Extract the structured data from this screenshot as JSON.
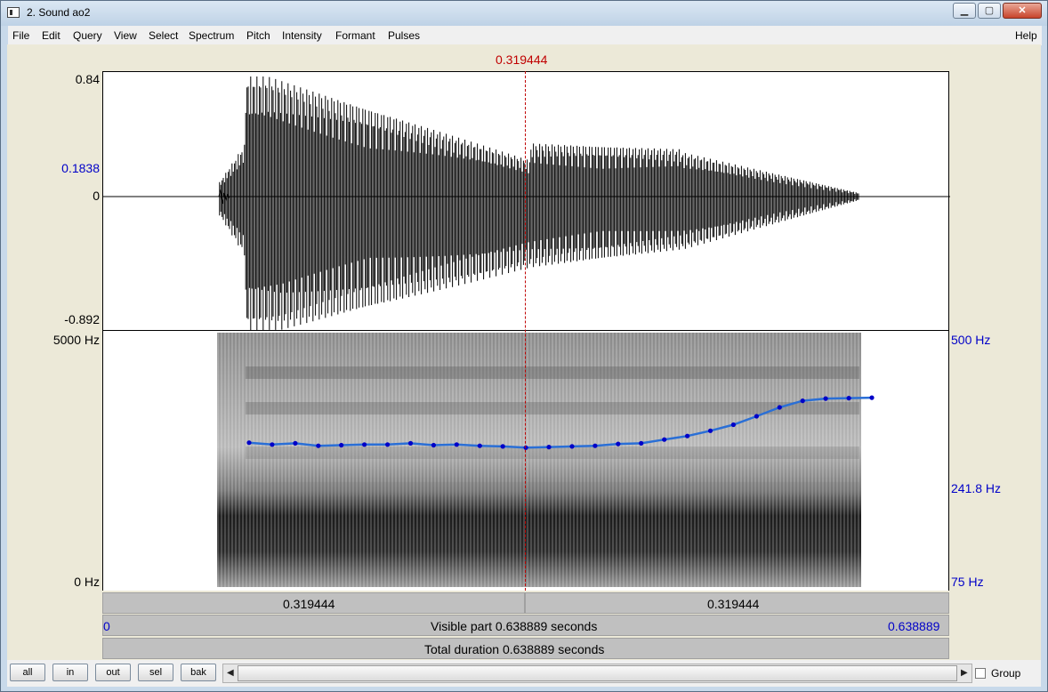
{
  "window": {
    "title": "2. Sound ao2",
    "controls": [
      "minimize",
      "maximize",
      "close"
    ]
  },
  "menu": {
    "items": [
      "File",
      "Edit",
      "Query",
      "View",
      "Select",
      "Spectrum",
      "Pitch",
      "Intensity",
      "Formant",
      "Pulses"
    ],
    "help": "Help"
  },
  "cursor": {
    "time_label": "0.319444",
    "time": 0.319444
  },
  "waveform": {
    "y_max": "0.84",
    "y_mark": "0.1838",
    "y_zero": "0",
    "y_min": "-0.892"
  },
  "spectrogram": {
    "freq_top": "5000 Hz",
    "freq_bottom": "0 Hz"
  },
  "pitch": {
    "top": "500 Hz",
    "mid": "241.8 Hz",
    "bottom": "75 Hz",
    "contour_hz": [
      221,
      218,
      220,
      216,
      217,
      218,
      218,
      220,
      217,
      218,
      216,
      215,
      213,
      214,
      215,
      216,
      219,
      220,
      226,
      232,
      241,
      252,
      268,
      286,
      300,
      305,
      306,
      307
    ]
  },
  "time_bar": {
    "left_label": "0.319444",
    "right_label": "0.319444"
  },
  "visible_bar": {
    "start": "0",
    "label": "Visible part 0.638889 seconds",
    "end": "0.638889",
    "duration": 0.638889
  },
  "total_bar": {
    "label": "Total duration 0.638889 seconds"
  },
  "buttons": {
    "all": "all",
    "in": "in",
    "out": "out",
    "sel": "sel",
    "bak": "bak"
  },
  "group": {
    "label": "Group",
    "checked": false
  },
  "colors": {
    "cursor": "#c00000",
    "pitch": "#0000c8",
    "label_blue": "#0000c8"
  }
}
